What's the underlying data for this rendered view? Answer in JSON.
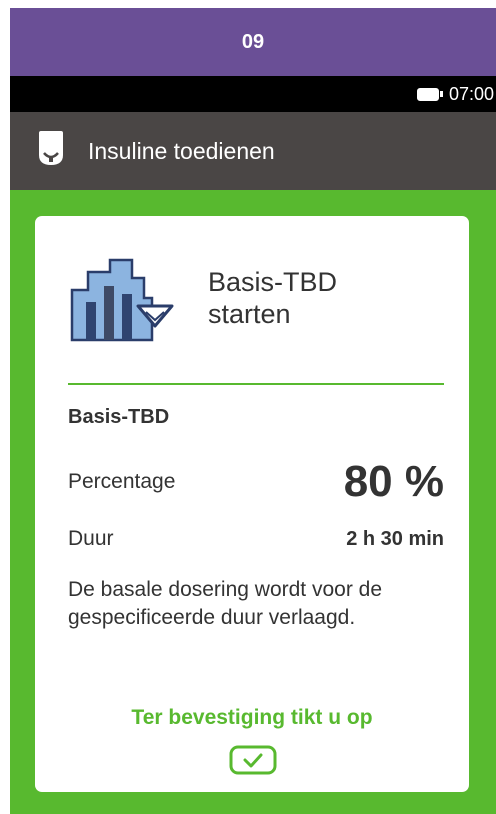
{
  "step_banner": {
    "label": "09"
  },
  "status_bar": {
    "time": "07:00",
    "battery_icon": "battery-icon"
  },
  "title_bar": {
    "icon": "pump-icon",
    "title": "Insuline toedienen"
  },
  "card": {
    "icon": "temporary-basal-rate-icon",
    "title_line1": "Basis-TBD",
    "title_line2": "starten",
    "section_label": "Basis-TBD",
    "percentage_label": "Percentage",
    "percentage_value": "80 %",
    "duration_label": "Duur",
    "duration_value": "2 h 30 min",
    "description": "De basale dosering wordt voor de gespecificeerde duur verlaagd.",
    "confirm_text": "Ter bevestiging tikt u op",
    "confirm_icon": "checkmark-icon"
  },
  "colors": {
    "banner": "#6a4f96",
    "title_bar": "#4a4645",
    "accent_green": "#58b92f",
    "status_bar": "#000000"
  }
}
